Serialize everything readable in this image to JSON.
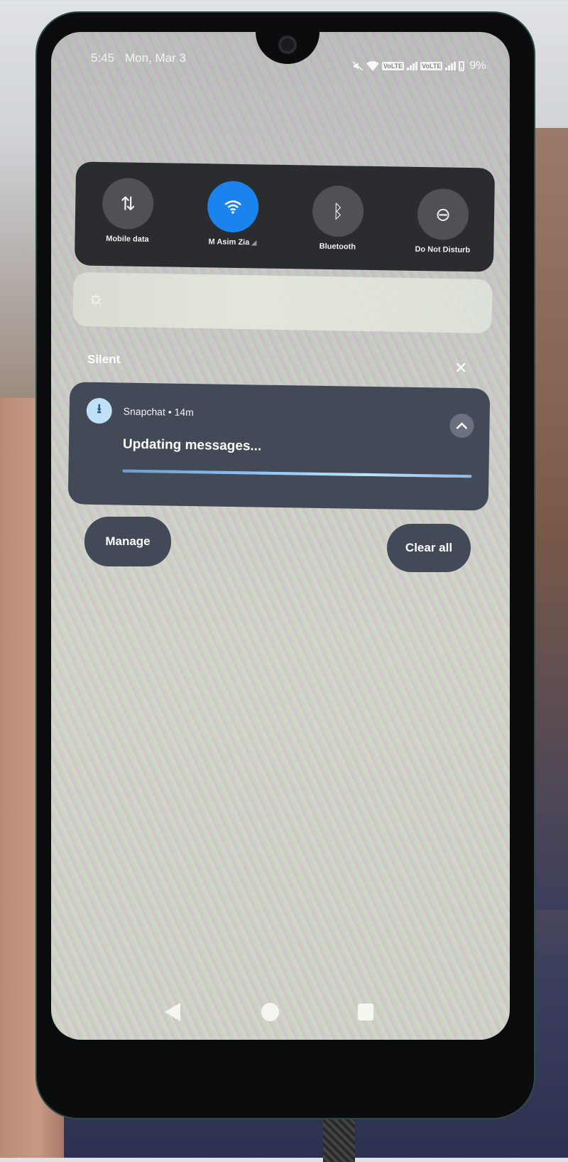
{
  "status_bar": {
    "time": "5:45",
    "date": "Mon, Mar 3",
    "icons": [
      "mute-icon",
      "wifi-icon",
      "volte-icon",
      "signal-icon",
      "volte-icon",
      "signal-icon",
      "battery-icon"
    ],
    "volte_label": "VoLTE",
    "battery_percent": "9%"
  },
  "quick_settings": {
    "tiles": [
      {
        "label": "Mobile data",
        "icon": "mobile-data-icon",
        "glyph": "⇅",
        "active": false
      },
      {
        "label": "M Asim Zia",
        "icon": "wifi-icon",
        "glyph": "",
        "active": true
      },
      {
        "label": "Bluetooth",
        "icon": "bluetooth-icon",
        "glyph": "ᛒ",
        "active": false
      },
      {
        "label": "Do Not Disturb",
        "icon": "dnd-icon",
        "glyph": "⊖",
        "active": false
      }
    ],
    "accent_color": "#1a83ee"
  },
  "brightness": {
    "icon": "brightness-sun-icon",
    "glyph": "☼",
    "level": 1.0
  },
  "notifications": {
    "section_label": "Silent",
    "dismiss_glyph": "✕",
    "items": [
      {
        "app": "Snapchat",
        "separator": "•",
        "time": "14m",
        "meta": "Snapchat • 14m",
        "title": "Updating messages...",
        "icon_glyph": "⭳",
        "expand_glyph": "︿",
        "progress": 1.0
      }
    ],
    "manage_label": "Manage",
    "clear_all_label": "Clear all"
  },
  "nav_bar": {
    "buttons": [
      "back",
      "home",
      "recents"
    ]
  }
}
